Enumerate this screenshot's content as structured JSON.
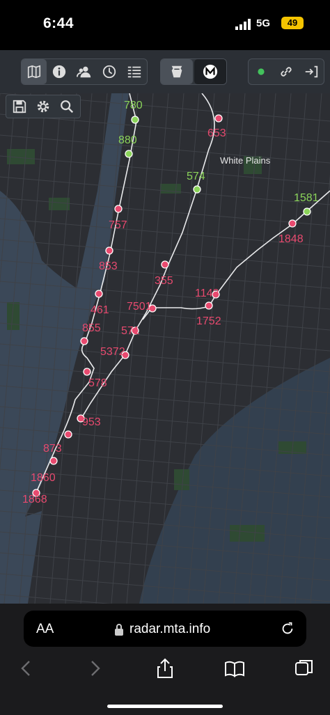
{
  "status": {
    "time": "6:44",
    "network": "5G",
    "battery": "49"
  },
  "toolbar": {
    "left_icons": [
      "map-icon",
      "info-icon",
      "users-icon",
      "clock-icon",
      "list-icon"
    ],
    "middle_icons": [
      "keystone-icon",
      "metro-icon"
    ],
    "right_icons": [
      "status-dot-icon",
      "link-icon",
      "login-icon"
    ],
    "status_dot_color": "#43c25c"
  },
  "map_controls": [
    "save-icon",
    "gear-icon",
    "search-icon"
  ],
  "map": {
    "place_label": "White Plains",
    "train_color_red": "#e84a6f",
    "train_color_green": "#8bd45a",
    "trains": [
      {
        "label": "780",
        "color": "green"
      },
      {
        "label": "653",
        "color": "red"
      },
      {
        "label": "880",
        "color": "green"
      },
      {
        "label": "574",
        "color": "green"
      },
      {
        "label": "1581",
        "color": "green"
      },
      {
        "label": "757",
        "color": "red"
      },
      {
        "label": "1848",
        "color": "red"
      },
      {
        "label": "853",
        "color": "red"
      },
      {
        "label": "355",
        "color": "red"
      },
      {
        "label": "1142",
        "color": "red"
      },
      {
        "label": "461",
        "color": "red"
      },
      {
        "label": "7501",
        "color": "red"
      },
      {
        "label": "1752",
        "color": "red"
      },
      {
        "label": "855",
        "color": "red"
      },
      {
        "label": "571",
        "color": "red"
      },
      {
        "label": "5372",
        "color": "red"
      },
      {
        "label": "578",
        "color": "red"
      },
      {
        "label": "953",
        "color": "red"
      },
      {
        "label": "873",
        "color": "red"
      },
      {
        "label": "1860",
        "color": "red"
      },
      {
        "label": "1868",
        "color": "red"
      }
    ]
  },
  "browser": {
    "text_size": "AA",
    "url": "radar.mta.info"
  }
}
